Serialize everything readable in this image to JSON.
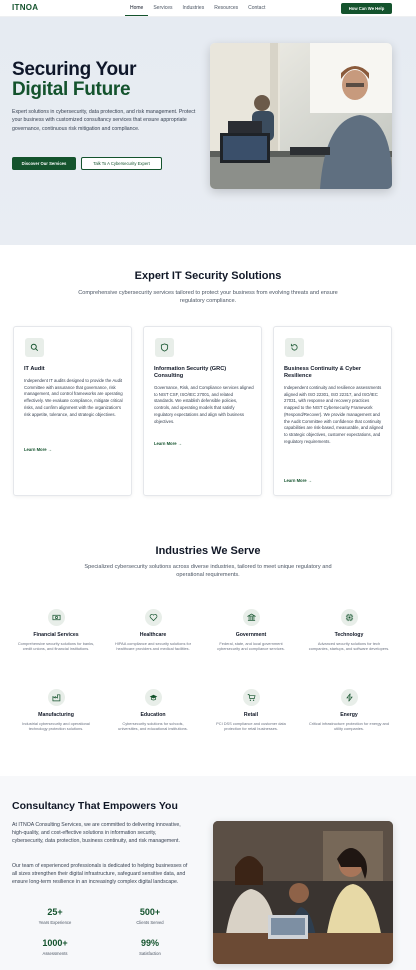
{
  "nav": {
    "logo": "ITNOA",
    "links": [
      "Home",
      "Services",
      "Industries",
      "Resources",
      "Contact"
    ],
    "cta": "How Can We Help"
  },
  "hero": {
    "title_line1": "Securing Your",
    "title_line2": "Digital Future",
    "description": "Expert solutions in cybersecurity, data protection, and risk management. Protect your business with customized consultancy services that ensure appropriate governance, continuous risk mitigation and compliance.",
    "btn_primary": "Discover Our Services",
    "btn_secondary": "Talk To A Cybersecurity Expert"
  },
  "solutions": {
    "title": "Expert IT Security Solutions",
    "subtitle": "Comprehensive cybersecurity services tailored to protect your business from evolving threats and ensure regulatory compliance.",
    "cards": [
      {
        "icon": "search-icon",
        "title": "IT Audit",
        "text": "Independent IT audits designed to provide the Audit Committee with assurance that governance, risk management, and control frameworks are operating effectively. We evaluate compliance, mitigate critical risks, and confirm alignment with the organization's risk appetite, tolerance, and strategic objectives.",
        "link": "Learn More →"
      },
      {
        "icon": "shield-icon",
        "title": "Information Security (GRC) Consulting",
        "text": "Governance, Risk, and Compliance services aligned to NIST CSF, ISO/IEC 27001, and related standards. We establish defensible policies, controls, and operating models that satisfy regulatory expectations and align with business objectives.",
        "link": "Learn More →"
      },
      {
        "icon": "refresh-icon",
        "title": "Business Continuity & Cyber Resilience",
        "text": "Independent continuity and resilience assessments aligned with ISO 22301, ISO 22317, and ISO/IEC 27031, with response and recovery practices mapped to the NIST Cybersecurity Framework (Respond/Recover). We provide management and the Audit Committee with confidence that continuity capabilities are risk-based, measurable, and aligned to strategic objectives, customer expectations, and regulatory requirements.",
        "link": "Learn More →"
      }
    ]
  },
  "industries": {
    "title": "Industries We Serve",
    "subtitle": "Specialized cybersecurity solutions across diverse industries, tailored to meet unique regulatory and operational requirements.",
    "items": [
      {
        "icon": "money-icon",
        "name": "Financial Services",
        "desc": "Comprehensive security solutions for banks, credit unions, and financial institutions."
      },
      {
        "icon": "heart-icon",
        "name": "Healthcare",
        "desc": "HIPAA compliance and security solutions for healthcare providers and medical facilities."
      },
      {
        "icon": "bank-icon",
        "name": "Government",
        "desc": "Federal, state, and local government cybersecurity and compliance services."
      },
      {
        "icon": "chip-icon",
        "name": "Technology",
        "desc": "Advanced security solutions for tech companies, startups, and software developers."
      },
      {
        "icon": "factory-icon",
        "name": "Manufacturing",
        "desc": "Industrial cybersecurity and operational technology protection solutions."
      },
      {
        "icon": "graduation-cap-icon",
        "name": "Education",
        "desc": "Cybersecurity solutions for schools, universities, and educational institutions."
      },
      {
        "icon": "cart-icon",
        "name": "Retail",
        "desc": "PCI DSS compliance and customer data protection for retail businesses."
      },
      {
        "icon": "bolt-icon",
        "name": "Energy",
        "desc": "Critical infrastructure protection for energy and utility companies."
      }
    ]
  },
  "consultancy": {
    "title": "Consultancy That Empowers You",
    "para1": "At ITNOA Consulting Services, we are committed to delivering innovative, high-quality, and cost-effective solutions in information security, cybersecurity, data protection, business continuity, and risk management.",
    "para2": "Our team of experienced professionals is dedicated to helping businesses of all sizes strengthen their digital infrastructure, safeguard sensitive data, and ensure long-term resilience in an increasingly complex digital landscape.",
    "stats": [
      {
        "value": "25+",
        "label": "Years Experience"
      },
      {
        "value": "500+",
        "label": "Clients Served"
      },
      {
        "value": "1000+",
        "label": "Assessments"
      },
      {
        "value": "99%",
        "label": "Satisfaction"
      }
    ]
  },
  "colors": {
    "brand": "#14532d",
    "hero_bg": "#e6ebf2",
    "icon_bg": "#e8eee9"
  }
}
